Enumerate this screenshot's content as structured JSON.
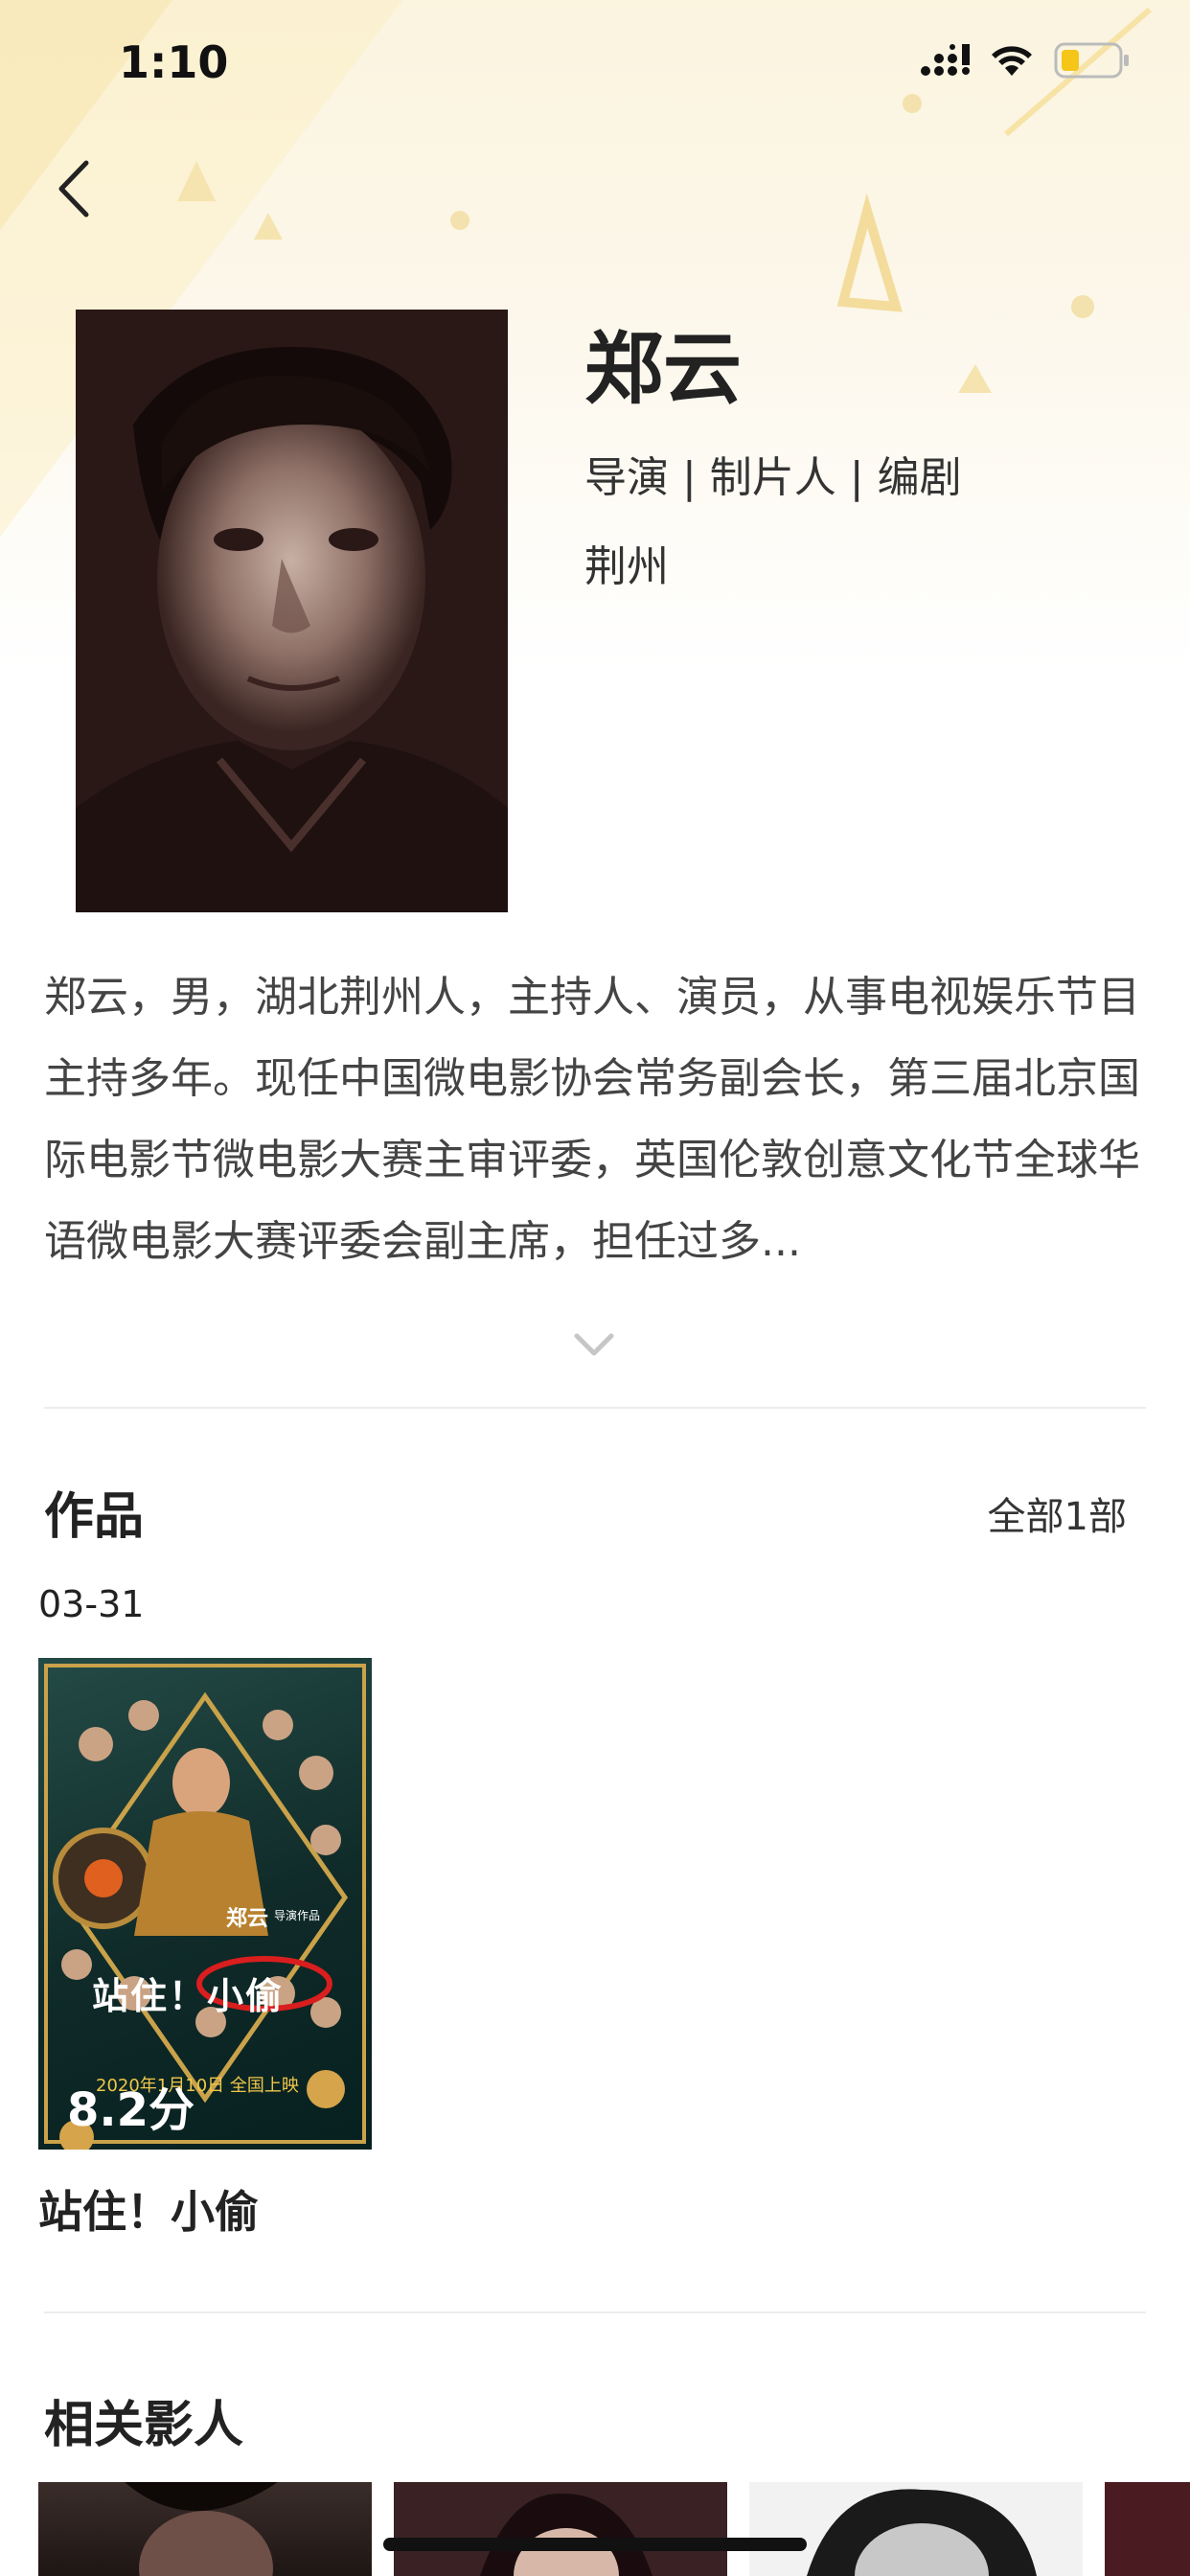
{
  "status": {
    "time": "1:10"
  },
  "profile": {
    "name": "郑云",
    "roles": "导演 | 制片人 | 编剧",
    "hometown": "荆州",
    "bio": "郑云，男，湖北荆州人，主持人、演员，从事电视娱乐节目主持多年。现任中国微电影协会常务副会长，第三届北京国际电影节微电影大赛主审评委，英国伦敦创意文化节全球华语微电影大赛评委会副主席，担任过多..."
  },
  "works": {
    "title": "作品",
    "more": "全部1部",
    "items": [
      {
        "date": "03-31",
        "title": "站住！小偷",
        "rating": "8.2分",
        "poster_text": {
          "director_credit": "郑云",
          "director_suffix": "导演作品",
          "logo": "站住！小偷",
          "release": "2020年1月10日 全国上映"
        }
      }
    ]
  },
  "related": {
    "title": "相关影人"
  },
  "colors": {
    "accent": "#f5c84a",
    "text": "#222222",
    "muted": "#444444",
    "divider": "#ececec"
  }
}
